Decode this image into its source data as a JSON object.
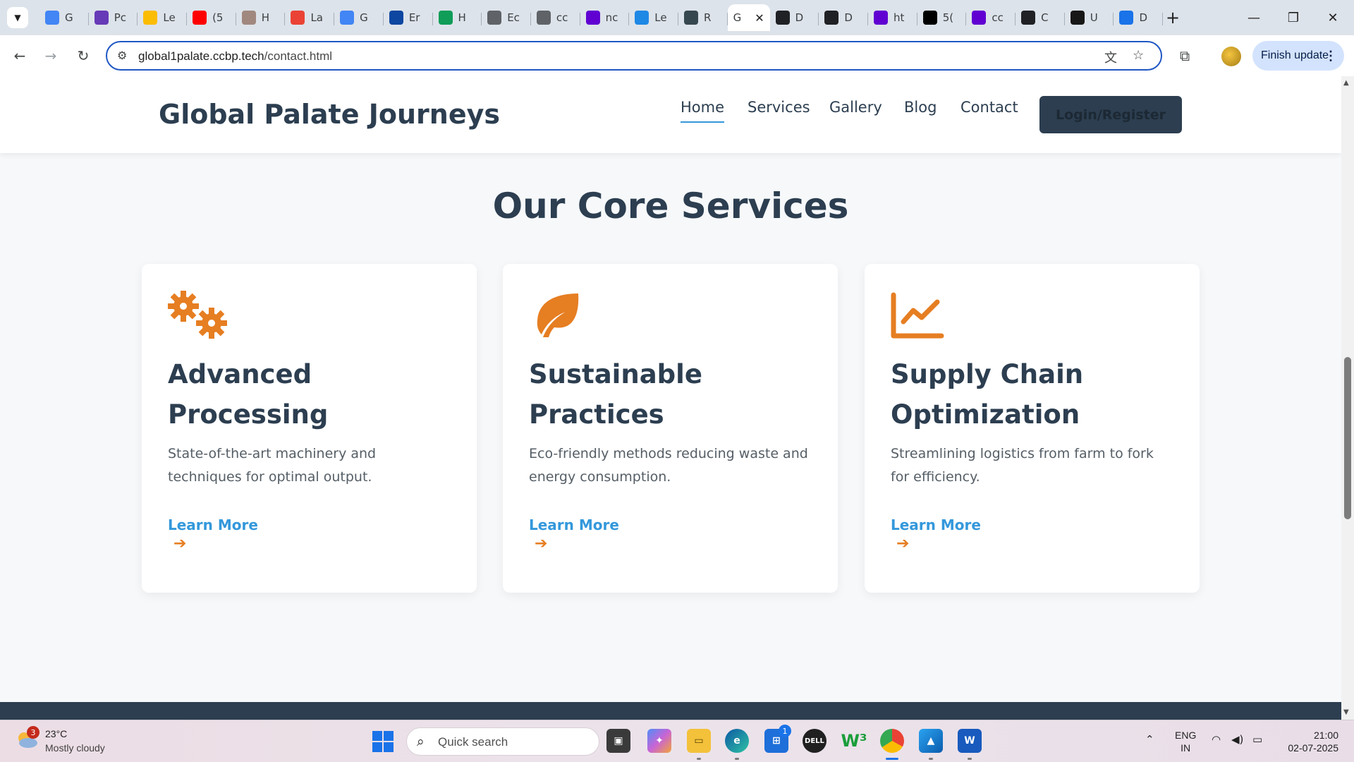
{
  "browser": {
    "tabs": [
      {
        "title": "G",
        "icon": "timer-icon",
        "color": "#4285f4"
      },
      {
        "title": "Pc",
        "icon": "form-icon",
        "color": "#673ab7"
      },
      {
        "title": "Le",
        "icon": "chart-icon",
        "color": "#fbbc04"
      },
      {
        "title": "(5",
        "icon": "youtube-icon",
        "color": "#ff0000"
      },
      {
        "title": "H",
        "icon": "avatar-icon",
        "color": "#a1887f"
      },
      {
        "title": "La",
        "icon": "gmail-icon",
        "color": "#ea4335"
      },
      {
        "title": "G",
        "icon": "gemini-icon",
        "color": "#4285f4"
      },
      {
        "title": "Er",
        "icon": "iet-icon",
        "color": "#0d47a1"
      },
      {
        "title": "H",
        "icon": "drive-icon",
        "color": "#0f9d58"
      },
      {
        "title": "Ec",
        "icon": "tab-icon",
        "color": "#5f6368"
      },
      {
        "title": "cc",
        "icon": "globe-icon",
        "color": "#5f6368"
      },
      {
        "title": "nc",
        "icon": "yahoo-icon",
        "color": "#6001d2"
      },
      {
        "title": "Le",
        "icon": "chart-icon",
        "color": "#1e88e5"
      },
      {
        "title": "R",
        "icon": "news-icon",
        "color": "#37474f"
      }
    ],
    "active_tab": {
      "title": "G",
      "close": "✕"
    },
    "tabs_after": [
      {
        "title": "D",
        "icon": "openai-icon",
        "color": "#202124"
      },
      {
        "title": "D",
        "icon": "openai-icon",
        "color": "#202124"
      },
      {
        "title": "ht",
        "icon": "yahoo-icon",
        "color": "#6001d2"
      },
      {
        "title": "5(",
        "icon": "bag-icon",
        "color": "#000000"
      },
      {
        "title": "cc",
        "icon": "yahoo-icon",
        "color": "#6001d2"
      },
      {
        "title": "C",
        "icon": "openai-icon",
        "color": "#202124"
      },
      {
        "title": "U",
        "icon": "github-icon",
        "color": "#181717"
      },
      {
        "title": "D",
        "icon": "download-icon",
        "color": "#1a73e8"
      }
    ],
    "url_host": "global1palate.ccbp.tech",
    "url_path": "/contact.html",
    "finish_update": "Finish update"
  },
  "site": {
    "brand": "Global Palate Journeys",
    "nav": [
      "Home",
      "Services",
      "Gallery",
      "Blog",
      "Contact"
    ],
    "login": "Login/Register",
    "section_title": "Our Core Services",
    "accent": "#e67e22",
    "link_color": "#3498db",
    "cards": [
      {
        "icon": "gears-icon",
        "title": "Advanced Processing",
        "text": "State-of-the-art machinery and techniques for optimal output.",
        "link": "Learn More",
        "arrow": "➔"
      },
      {
        "icon": "leaf-icon",
        "title": "Sustainable Practices",
        "text": "Eco-friendly methods reducing waste and energy consumption.",
        "link": "Learn More",
        "arrow": "➔"
      },
      {
        "icon": "line-chart-icon",
        "title": "Supply Chain Optimization",
        "text": "Streamlining logistics from farm to fork for efficiency.",
        "link": "Learn More",
        "arrow": "➔"
      }
    ]
  },
  "taskbar": {
    "weather_badge": "3",
    "temperature": "23°C",
    "condition": "Mostly cloudy",
    "search_placeholder": "Quick search",
    "badge_store": "1",
    "lang_1": "ENG",
    "lang_2": "IN",
    "time": "21:00",
    "date": "02-07-2025"
  }
}
